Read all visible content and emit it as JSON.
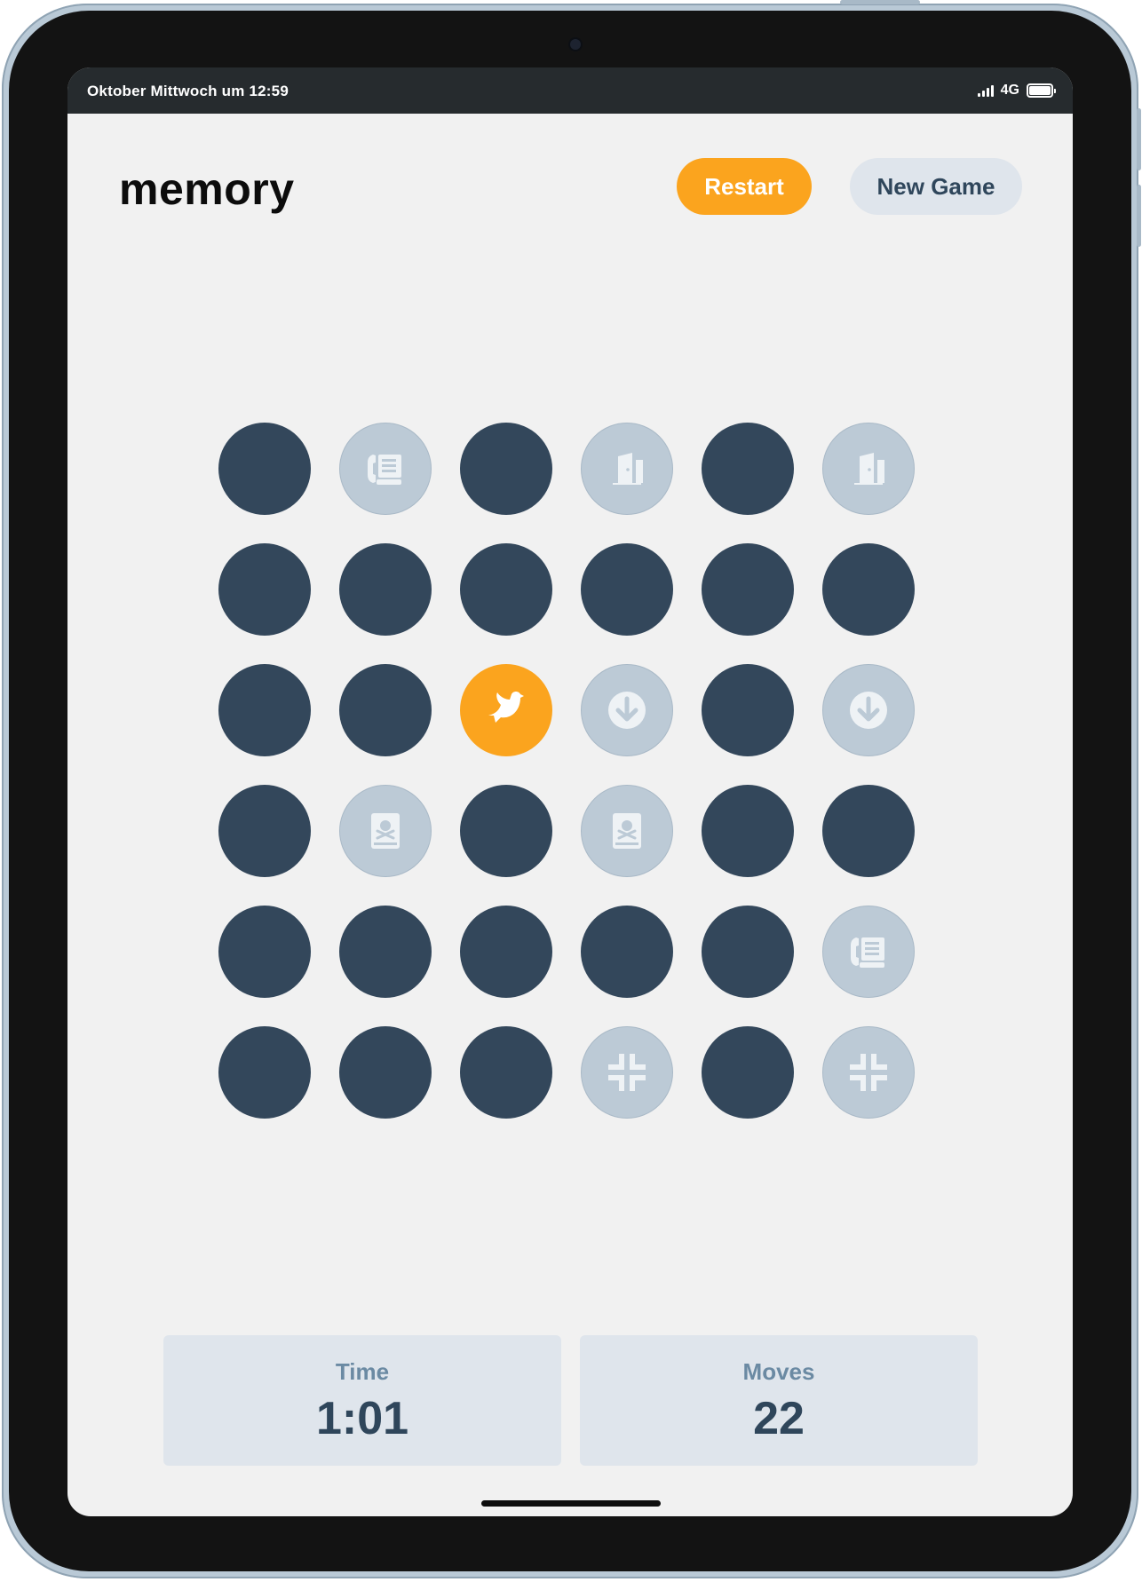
{
  "status_bar": {
    "time": "Oktober Mittwoch um 12:59",
    "network": "4G",
    "signal_icon": "cellular-signal-icon",
    "battery_icon": "battery-full-icon"
  },
  "header": {
    "title": "memory",
    "restart_label": "Restart",
    "new_game_label": "New Game"
  },
  "colors": {
    "hidden_tile": "#33475b",
    "matched_tile": "#bccad6",
    "active_tile": "#fba41e",
    "accent": "#fba41e",
    "background": "#f1f1f1"
  },
  "board": {
    "rows": 6,
    "cols": 6,
    "tiles": [
      {
        "state": "hidden"
      },
      {
        "state": "matched",
        "icon": "fax-icon"
      },
      {
        "state": "hidden"
      },
      {
        "state": "matched",
        "icon": "door-open-icon"
      },
      {
        "state": "hidden"
      },
      {
        "state": "matched",
        "icon": "door-open-icon"
      },
      {
        "state": "hidden"
      },
      {
        "state": "hidden"
      },
      {
        "state": "hidden"
      },
      {
        "state": "hidden"
      },
      {
        "state": "hidden"
      },
      {
        "state": "hidden"
      },
      {
        "state": "hidden"
      },
      {
        "state": "hidden"
      },
      {
        "state": "active",
        "icon": "dove-icon"
      },
      {
        "state": "matched",
        "icon": "arrow-circle-down-icon"
      },
      {
        "state": "hidden"
      },
      {
        "state": "matched",
        "icon": "arrow-circle-down-icon"
      },
      {
        "state": "hidden"
      },
      {
        "state": "matched",
        "icon": "poison-book-icon"
      },
      {
        "state": "hidden"
      },
      {
        "state": "matched",
        "icon": "poison-book-icon"
      },
      {
        "state": "hidden"
      },
      {
        "state": "hidden"
      },
      {
        "state": "hidden"
      },
      {
        "state": "hidden"
      },
      {
        "state": "hidden"
      },
      {
        "state": "hidden"
      },
      {
        "state": "hidden"
      },
      {
        "state": "matched",
        "icon": "fax-icon"
      },
      {
        "state": "hidden"
      },
      {
        "state": "hidden"
      },
      {
        "state": "hidden"
      },
      {
        "state": "matched",
        "icon": "compress-icon"
      },
      {
        "state": "hidden"
      },
      {
        "state": "matched",
        "icon": "compress-icon"
      }
    ]
  },
  "stats": {
    "time_label": "Time",
    "time_value": "1:01",
    "moves_label": "Moves",
    "moves_value": "22"
  }
}
